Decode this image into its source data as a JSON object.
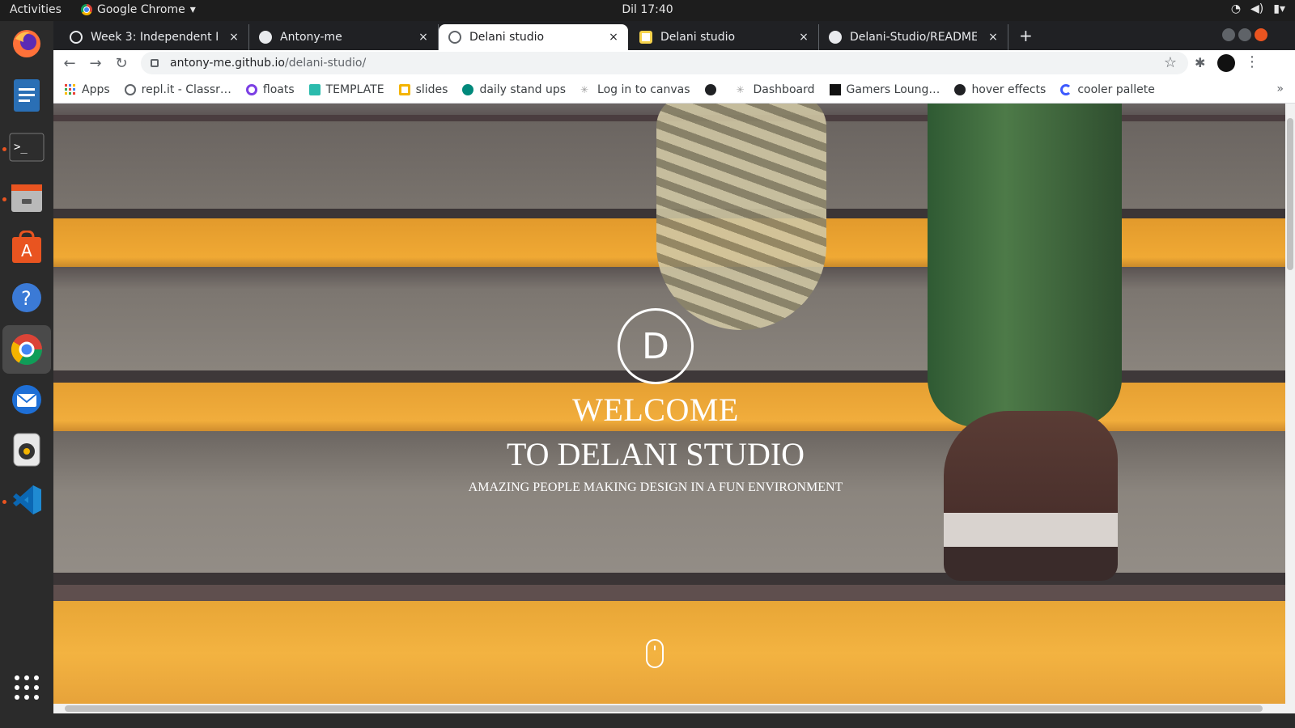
{
  "system": {
    "activities": "Activities",
    "app_name": "Google Chrome",
    "clock": "Dil 17:40"
  },
  "tabs": [
    {
      "title": "Week 3: Independent Pro",
      "close": "×",
      "icon": "canvas-icon"
    },
    {
      "title": "Antony-me",
      "close": "×",
      "icon": "github-icon"
    },
    {
      "title": "Delani studio",
      "close": "×",
      "icon": "globe-icon",
      "active": true
    },
    {
      "title": "Delani studio",
      "close": "×",
      "icon": "delani-icon"
    },
    {
      "title": "Delani-Studio/README.m",
      "close": "×",
      "icon": "github-icon"
    }
  ],
  "toolbar": {
    "url_host": "antony-me.github.io",
    "url_path": "/delani-studio/"
  },
  "bookmarks": [
    {
      "label": "Apps",
      "color": "#4285f4"
    },
    {
      "label": "repl.it - Classr…",
      "color": "#5f6368"
    },
    {
      "label": "floats",
      "color": "#7b3fe4"
    },
    {
      "label": "TEMPLATE",
      "color": "#2bbbad"
    },
    {
      "label": "slides",
      "color": "#f4b400"
    },
    {
      "label": "daily stand ups",
      "color": "#00897b"
    },
    {
      "label": "Log in to canvas",
      "color": "#9e9e9e"
    },
    {
      "label": "",
      "color": "#202124"
    },
    {
      "label": "Dashboard",
      "color": "#9e9e9e"
    },
    {
      "label": "Gamers Loung…",
      "color": "#111111"
    },
    {
      "label": "hover effects",
      "color": "#202124"
    },
    {
      "label": "cooler pallete",
      "color": "#3d5afe"
    }
  ],
  "hero": {
    "logo_letter": "D",
    "line1": "WELCOME",
    "line2": "TO DELANI STUDIO",
    "tagline": "AMAZING PEOPLE MAKING DESIGN IN A FUN ENVIRONMENT"
  },
  "colors": {
    "accent": "#e95420",
    "stripe": "#f0a934"
  }
}
